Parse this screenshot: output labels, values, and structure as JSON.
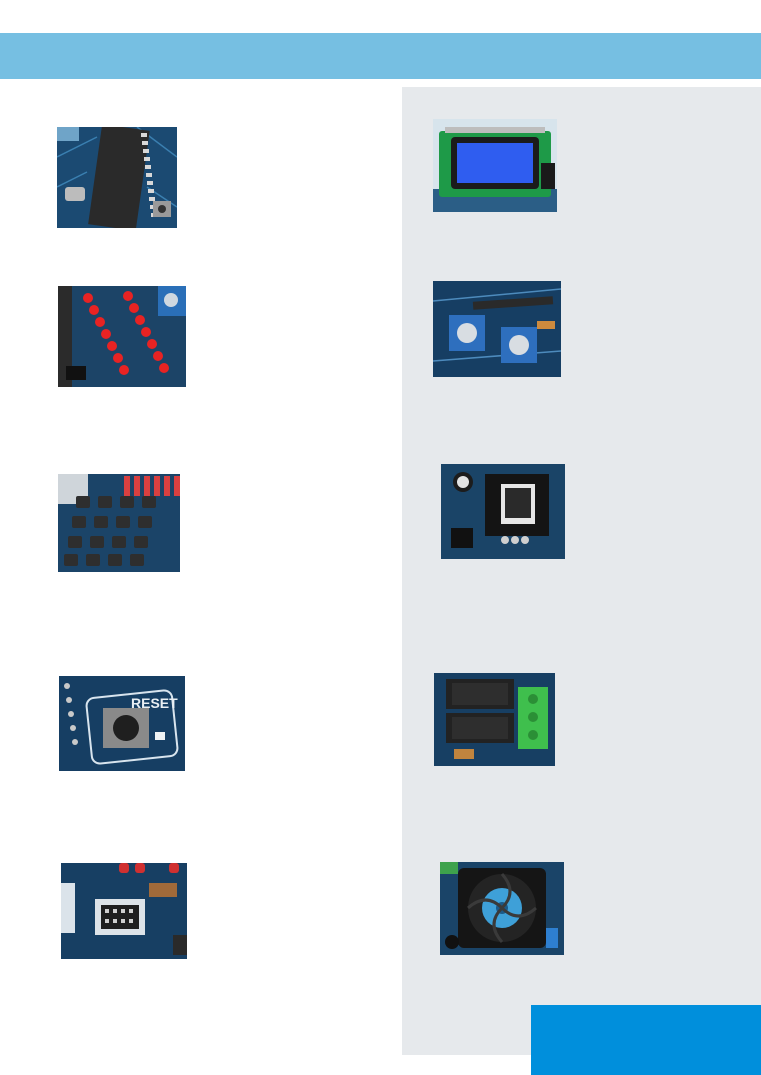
{
  "colors": {
    "header_band": "#76bfe2",
    "side_panel": "#e6e9ec",
    "corner_block": "#008fdc",
    "pcb_blue": "#163e63"
  },
  "photos": {
    "left": [
      {
        "id": "microcontroller-photo"
      },
      {
        "id": "led-array-photo"
      },
      {
        "id": "keypad-photo"
      },
      {
        "id": "reset-button-photo",
        "label": "RESET"
      },
      {
        "id": "icsp-connector-photo"
      }
    ],
    "right": [
      {
        "id": "lcd-display-photo"
      },
      {
        "id": "potentiometer-photo"
      },
      {
        "id": "sensor-socket-photo"
      },
      {
        "id": "relay-photo"
      },
      {
        "id": "cooling-fan-photo"
      }
    ]
  }
}
